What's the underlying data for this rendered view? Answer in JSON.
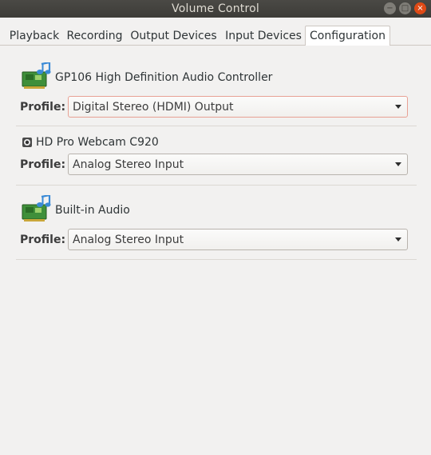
{
  "window": {
    "title": "Volume Control"
  },
  "tabs": [
    {
      "label": "Playback"
    },
    {
      "label": "Recording"
    },
    {
      "label": "Output Devices"
    },
    {
      "label": "Input Devices"
    },
    {
      "label": "Configuration",
      "active": true
    }
  ],
  "devices": [
    {
      "name": "GP106 High Definition Audio Controller",
      "icon": "sound-card-icon",
      "profile_label": "Profile:",
      "profile": "Digital Stereo (HDMI) Output"
    },
    {
      "name": "HD Pro Webcam C920",
      "icon": "webcam-icon",
      "profile_label": "Profile:",
      "profile": "Analog Stereo Input"
    },
    {
      "name": "Built-in Audio",
      "icon": "sound-card-icon",
      "profile_label": "Profile:",
      "profile": "Analog Stereo Input"
    }
  ],
  "colors": {
    "titlebar": "#3d3c38",
    "close_button": "#df4a16",
    "focus_border": "#e8a194"
  }
}
